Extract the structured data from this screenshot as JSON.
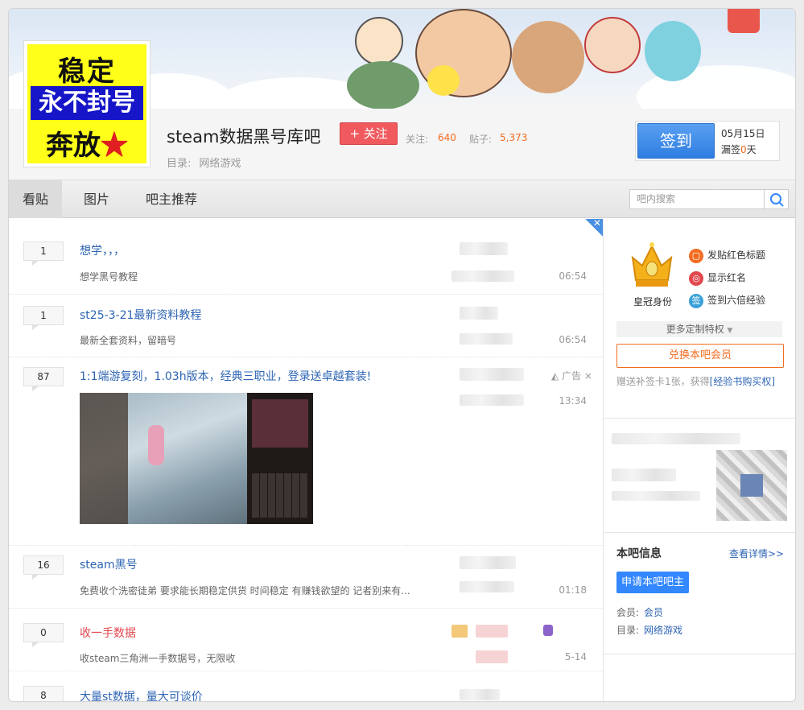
{
  "forum": {
    "title": "steam数据黑号库吧",
    "follow_label": "+ 关注",
    "follow_count_label": "关注:",
    "follow_count": "640",
    "post_count_label": "贴子:",
    "post_count": "5,373",
    "directory_label": "目录:",
    "directory_value": "网络游戏",
    "logo_lines": [
      "稳定",
      "永不封号",
      "奔放★"
    ]
  },
  "sign": {
    "button_label": "签到",
    "date": "05月15日",
    "missed_prefix": "漏签",
    "missed_days": "0",
    "missed_suffix": "天"
  },
  "nav": {
    "tabs": [
      "看贴",
      "图片",
      "吧主推荐"
    ],
    "search_placeholder": "吧内搜索"
  },
  "threads": [
    {
      "replies": "1",
      "title": "想学，，，",
      "abstract": "想学黑号教程",
      "time": "06:54"
    },
    {
      "replies": "1",
      "title": "st25-3-21最新资料教程",
      "abstract": "最新全套资料，留暗号",
      "time": "06:54"
    },
    {
      "replies": "87",
      "title": "1:1端游复刻，1.03h版本，经典三职业，登录送卓越套装!",
      "abstract": "",
      "time": "13:34",
      "ad_label": "广告"
    },
    {
      "replies": "16",
      "title": "steam黑号",
      "abstract": "免费收个洗密徒弟 要求能长期稳定供货 时间稳定 有赚钱欲望的 记者别来有...",
      "time": "01:18"
    },
    {
      "replies": "0",
      "title": "收一手数据",
      "abstract": "收steam三角洲一手数据号，无限收",
      "time": "5-14"
    },
    {
      "replies": "8",
      "title": "大量st数据，量大可谈价",
      "abstract": "",
      "time": ""
    }
  ],
  "aside": {
    "crown_label": "皇冠身份",
    "privileges": [
      "发贴红色标题",
      "显示红名",
      "签到六倍经验"
    ],
    "privilege_icons": [
      "bookmark-icon",
      "message-icon",
      "sign-icon"
    ],
    "privilege_icon_text": [
      "▢",
      "◎",
      "签"
    ],
    "more_privileges": "更多定制特权",
    "redeem_label": "兑换本吧会员",
    "gift_text": "赠送补签卡1张，获得",
    "gift_link": "[经验书购买权]",
    "info_title": "本吧信息",
    "info_more": "查看详情>>",
    "apply_label": "申请本吧吧主",
    "member_label": "会员:",
    "member_value": "会员",
    "dir_label": "目录:",
    "dir_value": "网络游戏"
  },
  "colors": {
    "link": "#2d64b3",
    "accent_orange": "#f36c21",
    "follow_red": "#f05a5e",
    "sign_blue": "#2e7de1",
    "apply_blue": "#3388ff"
  }
}
